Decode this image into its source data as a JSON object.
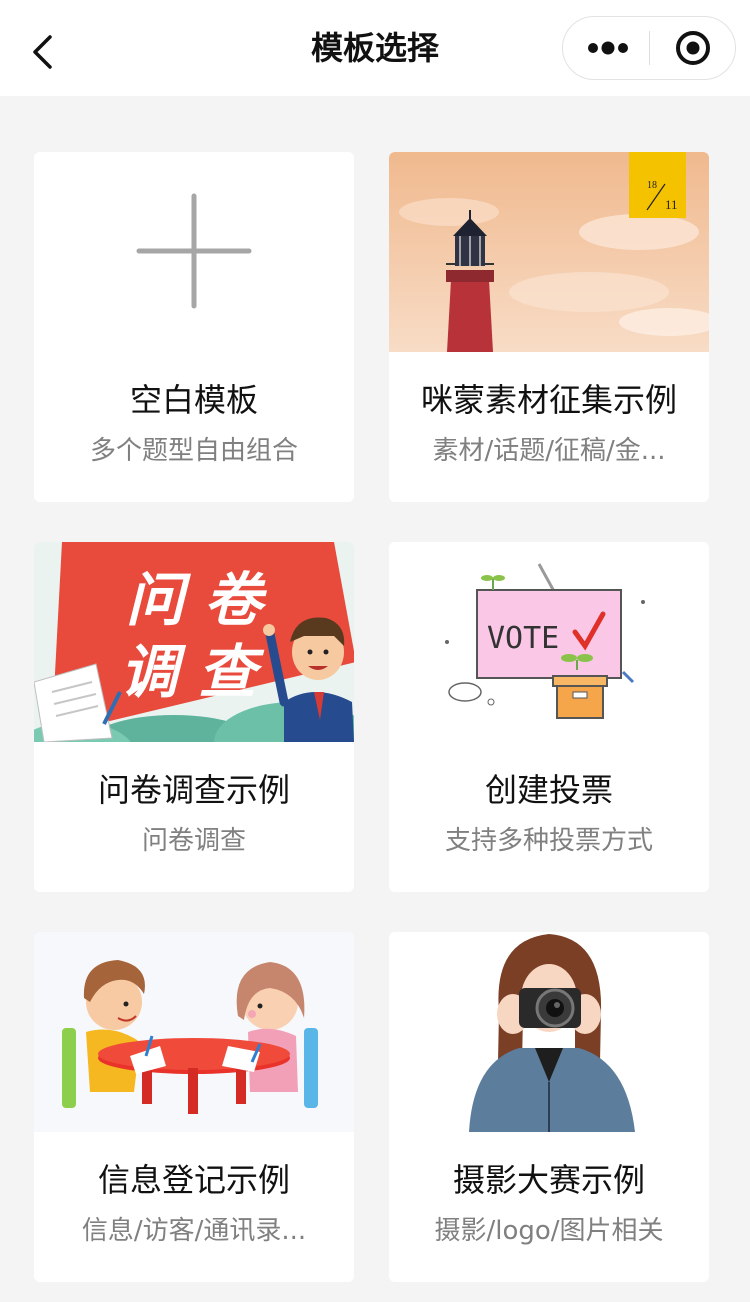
{
  "header": {
    "title": "模板选择",
    "back_icon": "chevron-left-icon",
    "more_icon": "more-dots-icon",
    "close_icon": "target-close-icon"
  },
  "templates": [
    {
      "title": "空白模板",
      "subtitle": "多个题型自由组合",
      "image": "plus-icon"
    },
    {
      "title": "咪蒙素材征集示例",
      "subtitle": "素材/话题/征稿/金...",
      "image": "lighthouse-illustration",
      "badge_top": "18",
      "badge_bottom": "11"
    },
    {
      "title": "问卷调查示例",
      "subtitle": "问卷调查",
      "image": "survey-banner-illustration",
      "banner_line1": "问 卷",
      "banner_line2": "调 查"
    },
    {
      "title": "创建投票",
      "subtitle": "支持多种投票方式",
      "image": "vote-illustration",
      "sign_text": "VOTE"
    },
    {
      "title": "信息登记示例",
      "subtitle": "信息/访客/通讯录...",
      "image": "kids-at-table-illustration"
    },
    {
      "title": "摄影大赛示例",
      "subtitle": "摄影/logo/图片相关",
      "image": "photographer-illustration"
    }
  ],
  "colors": {
    "page_bg": "#f4f4f4",
    "card_bg": "#ffffff",
    "title_text": "#111111",
    "subtitle_text": "#808080",
    "survey_red": "#e84a3c",
    "badge_yellow": "#f5c200"
  }
}
